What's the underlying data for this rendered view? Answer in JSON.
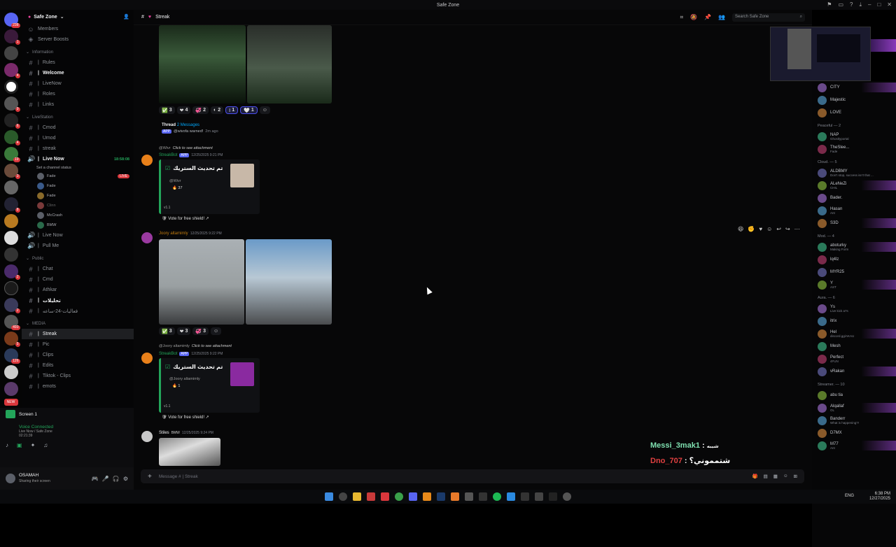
{
  "window": {
    "title": "Safe Zone"
  },
  "server": {
    "name": "Safe Zone",
    "members_label": "Members",
    "boosts_label": "Server Boosts"
  },
  "channels": {
    "cat_information": "Information",
    "rules": "Rules",
    "welcome": "Welcome",
    "livenow": "LiveNow",
    "roles": "Roles",
    "links": "Links",
    "cat_livestation": "LiveStation",
    "cmod": "Cmod",
    "umod": "Umod",
    "streak": "streak",
    "live_now": "Live Now",
    "live_time": "18:58:08",
    "status": "Set a channel status",
    "voice_users": [
      "Fade",
      "Fade",
      "Fade",
      "Clinn",
      "McCrash",
      "BMW"
    ],
    "live_badge": "LIVE",
    "live_now2": "Live Now",
    "pull_me": "Pull Me",
    "cat_public": "Public",
    "chat": "Chat",
    "cmd": "Cmd",
    "athkar": "Athkar",
    "tahleel": "تحليلات",
    "events24": "فعاليات-24-ساعه",
    "cat_media": "MEDIA",
    "media_streak": "Streak",
    "pic": "Pic",
    "clips": "Clips",
    "edits": "Edits",
    "tiktok": "Tiktok - Clips",
    "emots": "emots"
  },
  "voice": {
    "screen": "Screen 1",
    "connected": "Voice Connected",
    "location": "Live Now / Safe Zone",
    "timer": "02:21:39"
  },
  "user": {
    "name": "OSAMAH",
    "status": "Sharing their screen"
  },
  "main": {
    "channel": "Streak",
    "search_placeholder": "Search Safe Zone",
    "reactions1": [
      "3",
      "4",
      "2",
      "2",
      "1",
      "1"
    ],
    "thread_label": "Thread",
    "thread_count": "2 Messages",
    "thread_preview": "@wivofa warned!",
    "thread_time": "2m ago",
    "reply1": "@Wivr",
    "reply1_action": "Click to see attachment",
    "bot_name": "StreakBot",
    "bot_tag": "APP",
    "bot_time1": "12/25/2025 9:21 PM",
    "embed_title": "تم تحديث الستريك",
    "embed1_user": "@Wivr",
    "embed1_count": "37",
    "embed_version": "v1.1",
    "vote": "Vote for free shield!",
    "msg2_author": "Joory altamimly",
    "msg2_time": "12/25/2025 9:22 PM",
    "reactions2": [
      "3",
      "3",
      "3"
    ],
    "reply2": "@Joory altamimly",
    "reply2_action": "Click to see attachment",
    "bot_time2": "12/25/2025 9:22 PM",
    "embed2_user": "@Joory altamimly",
    "embed2_count": "1",
    "msg3_author": "Stiles",
    "msg3_tag": "BMW",
    "msg3_time": "12/25/2025 9:24 PM",
    "overlay1_name": "Messi_3mak1",
    "overlay1_text": "شيبه",
    "overlay2_name": "Dno_707",
    "overlay2_text": "شتمموني؟",
    "input_placeholder": "Message # | Streak"
  },
  "members": {
    "groups": [
      {
        "label": "",
        "items": [
          {
            "n": "CITY"
          },
          {
            "n": "Majestic"
          },
          {
            "n": "LOVE"
          }
        ]
      },
      {
        "label": "Peaceful — 2",
        "items": [
          {
            "n": "NAP",
            "s": "Ghostlyportal"
          },
          {
            "n": "TheSlee...",
            "s": "Fade"
          }
        ]
      },
      {
        "label": "Cloud. — 5",
        "items": [
          {
            "n": "ALDBMY",
            "s": "Don't stop, success isn't that ..."
          },
          {
            "n": "ALeNeZi",
            "s": "CHIL"
          },
          {
            "n": "Bader."
          },
          {
            "n": "Hasan",
            "s": "Ant"
          },
          {
            "n": "S3D"
          }
        ]
      },
      {
        "label": "Mod. — 4",
        "items": [
          {
            "n": "aboturky",
            "s": "Making Form"
          },
          {
            "n": "lq4lz"
          },
          {
            "n": "MYR25"
          },
          {
            "n": "Y",
            "s": "AST"
          }
        ]
      },
      {
        "label": "Aura. — 6",
        "items": [
          {
            "n": "Ys",
            "s": "Live kick a7s"
          },
          {
            "n": "itrix"
          },
          {
            "n": "Hel",
            "s": "discord.gg/AKAU"
          },
          {
            "n": "Mesh"
          },
          {
            "n": "Perfect",
            "s": "4FUN"
          },
          {
            "n": "vRakan"
          }
        ]
      },
      {
        "label": "Streamer. — 10",
        "items": [
          {
            "n": "abu tia"
          },
          {
            "n": "Alqallaf",
            "s": "OL"
          },
          {
            "n": "Banderr",
            "s": "What is happening?!"
          },
          {
            "n": "D7MX"
          },
          {
            "n": "M77",
            "s": "Ant"
          }
        ]
      }
    ]
  },
  "taskbar": {
    "lang": "ENG",
    "time": "6:38 PM",
    "date": "12/27/2025"
  }
}
